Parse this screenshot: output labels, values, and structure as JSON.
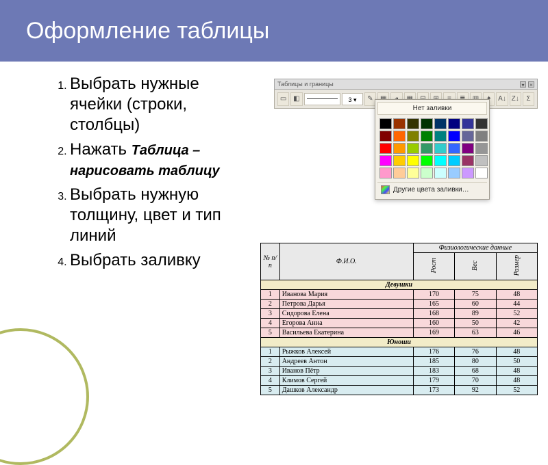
{
  "header": {
    "title": "Оформление таблицы"
  },
  "steps": [
    {
      "text": "Выбрать нужные ячейки (строки, столбцы)"
    },
    {
      "prefix": "Нажать ",
      "emph": "Таблица – нарисовать таблицу"
    },
    {
      "text": "Выбрать нужную толщину, цвет и тип линий"
    },
    {
      "text": "Выбрать заливку"
    }
  ],
  "toolbar": {
    "window_title": "Таблицы и границы",
    "line_weight": "3",
    "no_fill": "Нет заливки",
    "more_colors": "Другие цвета заливки…"
  },
  "palette": [
    "#000000",
    "#993300",
    "#333300",
    "#003300",
    "#003366",
    "#000080",
    "#333399",
    "#333333",
    "#800000",
    "#ff6600",
    "#808000",
    "#008000",
    "#008080",
    "#0000ff",
    "#666699",
    "#808080",
    "#ff0000",
    "#ff9900",
    "#99cc00",
    "#339966",
    "#33cccc",
    "#3366ff",
    "#800080",
    "#969696",
    "#ff00ff",
    "#ffcc00",
    "#ffff00",
    "#00ff00",
    "#00ffff",
    "#00ccff",
    "#993366",
    "#c0c0c0",
    "#ff99cc",
    "#ffcc99",
    "#ffff99",
    "#ccffcc",
    "#ccffff",
    "#99ccff",
    "#cc99ff",
    "#ffffff"
  ],
  "table": {
    "headers": {
      "num": "№ п/п",
      "fio": "Ф.И.О.",
      "group": "Физиологические данные",
      "height": "Рост",
      "weight": "Вес",
      "size": "Размер"
    },
    "sections": [
      {
        "title": "Девушки",
        "class": "girls",
        "rows": [
          [
            "1",
            "Иванова Мария",
            "170",
            "75",
            "48"
          ],
          [
            "2",
            "Петрова Дарья",
            "165",
            "60",
            "44"
          ],
          [
            "3",
            "Сидорова Елена",
            "168",
            "89",
            "52"
          ],
          [
            "4",
            "Егорова Анна",
            "160",
            "50",
            "42"
          ],
          [
            "5",
            "Васильева Екатерина",
            "169",
            "63",
            "46"
          ]
        ]
      },
      {
        "title": "Юноши",
        "class": "boys",
        "rows": [
          [
            "1",
            "Рыжков Алексей",
            "176",
            "76",
            "48"
          ],
          [
            "2",
            "Андреев Антон",
            "185",
            "80",
            "50"
          ],
          [
            "3",
            "Иванов Пётр",
            "183",
            "68",
            "48"
          ],
          [
            "4",
            "Климов Сергей",
            "179",
            "70",
            "48"
          ],
          [
            "5",
            "Дашков Александр",
            "173",
            "92",
            "52"
          ]
        ]
      }
    ]
  }
}
